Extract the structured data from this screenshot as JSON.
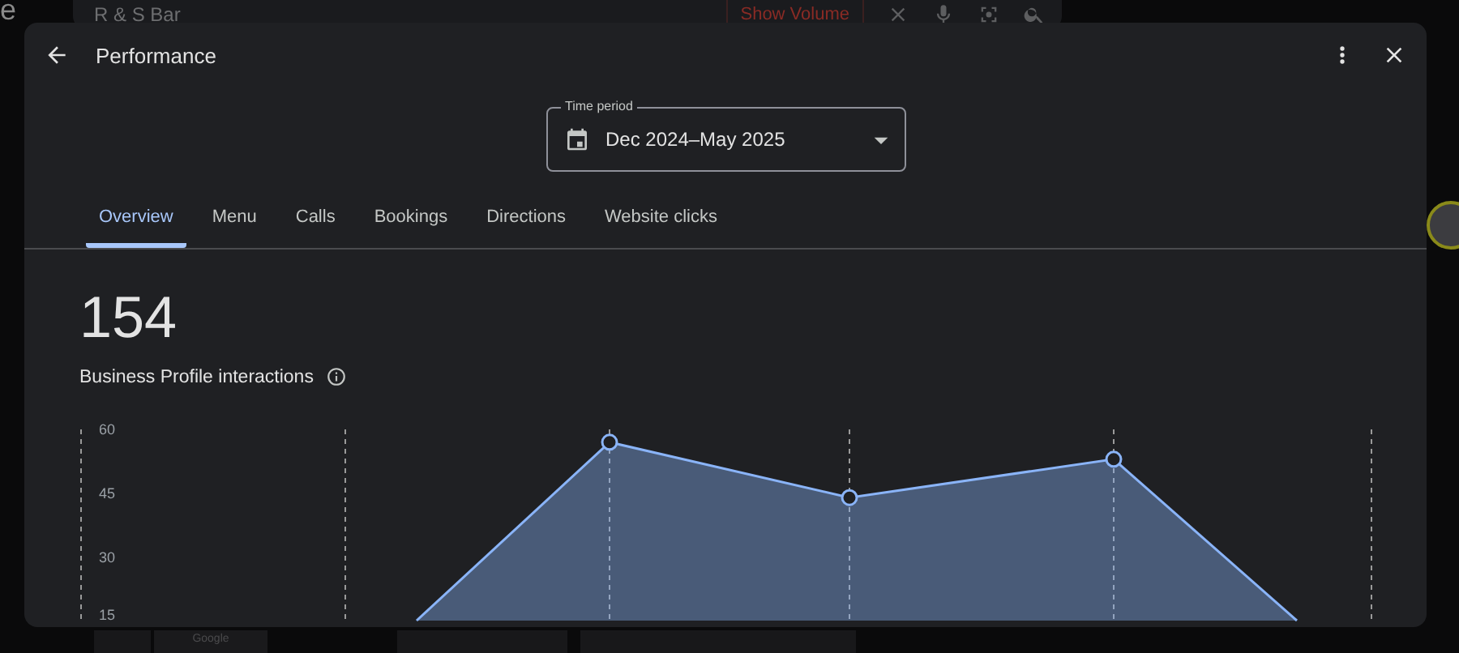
{
  "backdrop": {
    "logo_fragment": "e",
    "search_text": "R & S Bar",
    "volume_button": "Show Volume",
    "footer_label": "Google"
  },
  "dialog": {
    "title": "Performance"
  },
  "time_period": {
    "label": "Time period",
    "value": "Dec 2024–May 2025"
  },
  "tabs": [
    {
      "label": "Overview",
      "selected": true
    },
    {
      "label": "Menu",
      "selected": false
    },
    {
      "label": "Calls",
      "selected": false
    },
    {
      "label": "Bookings",
      "selected": false
    },
    {
      "label": "Directions",
      "selected": false
    },
    {
      "label": "Website clicks",
      "selected": false
    }
  ],
  "summary": {
    "total": "154",
    "label": "Business Profile interactions"
  },
  "chart": {
    "y_labels": [
      "60",
      "45",
      "30",
      "15"
    ]
  }
}
